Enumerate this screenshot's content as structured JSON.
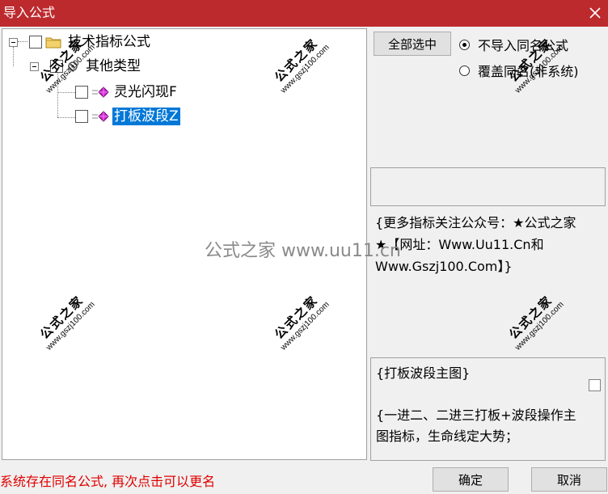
{
  "window": {
    "title": "导入公式",
    "close_glyph": "✕"
  },
  "tree": {
    "root": {
      "label": "技术指标公式",
      "icon": "folder-icon"
    },
    "group": {
      "label": "其他类型",
      "icon": "folder-gear-icon"
    },
    "items": [
      {
        "label": "灵光闪现F",
        "icon": "gem-icon",
        "selected": false
      },
      {
        "label": "打板波段Z",
        "icon": "gem-icon",
        "selected": true
      }
    ]
  },
  "options": {
    "select_all_label": "全部选中",
    "radio_no_import": "不导入同名公式",
    "radio_overwrite": "覆盖同名(非系统)",
    "checked": "no_import"
  },
  "description": {
    "text": "{更多指标关注公众号：★公式之家★【网址：Www.Uu11.Cn和Www.Gszj100.Com】}"
  },
  "formula": {
    "text": "{打板波段主图}\n\n{一进二、二进三打板+波段操作主图指标，生命线定大势；"
  },
  "status": {
    "message": "系统存在同名公式, 再次点击可以更名"
  },
  "buttons": {
    "ok": "确定",
    "cancel": "取消"
  },
  "watermarks": {
    "stamp_cn": "公式之家",
    "stamp_url": "www.gszj100.com",
    "center": "公式之家 www.uu11.cn"
  },
  "colors": {
    "titlebar": "#bd2a2e",
    "selection": "#0078d7",
    "status_text": "#e00000"
  }
}
